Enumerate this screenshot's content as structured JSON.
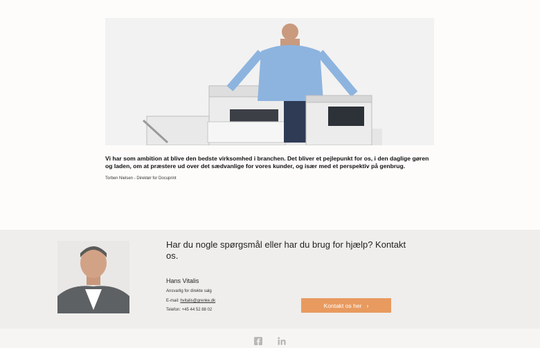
{
  "quote": {
    "text": "Vi har som ambition at blive den bedste virksomhed i branchen. Det bliver et pejlepunkt for os, i den daglige gøren og laden, om at præstere ud over det sædvanlige for vores kunder, og især med et perspektiv på genbrug.",
    "author": "Torben Nielsen - Direktør for Docuprint"
  },
  "contact": {
    "heading": "Har du nogle spørgsmål eller har du brug for hjælp? Kontakt os.",
    "name": "Hans Vitalis",
    "role": "Ansvarlig for direkte salg",
    "email_label": "E-mail: ",
    "email": "hvitalis@grenke.dk",
    "phone": "Telefon: +45 44 52 88 02",
    "button_label": "Kontakt os her"
  },
  "footer": {
    "icons": [
      "facebook-icon",
      "linkedin-icon"
    ]
  },
  "colors": {
    "accent": "#e89a5f",
    "band": "#efeeec"
  }
}
